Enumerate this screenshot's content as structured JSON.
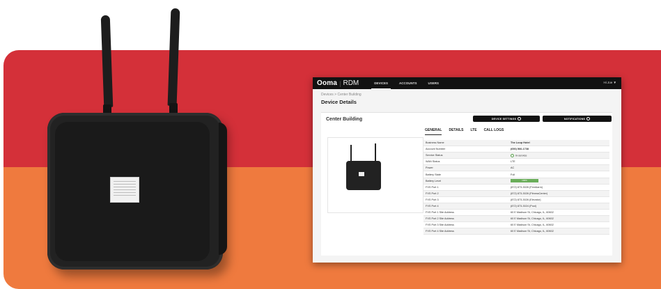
{
  "colors": {
    "red_band": "#d43039",
    "orange_band": "#ef7a3e",
    "accent": "#121212",
    "battery": "#6aad5a"
  },
  "header": {
    "logo": "Ooma",
    "separator": "|",
    "product": "RDM",
    "nav": [
      "DEVICES",
      "ACCOUNTS",
      "USERS"
    ],
    "active_nav": "DEVICES",
    "user": "Hi Joe ▼"
  },
  "breadcrumb": "Devices  >  Center Building",
  "page_title": "Device Details",
  "device": {
    "name": "Center Building",
    "buttons": {
      "settings": "DEVICE SETTINGS",
      "notifications": "NOTIFICATIONS"
    },
    "tabs": [
      "GENERAL",
      "DETAILS",
      "LTE",
      "CALL LOGS"
    ],
    "active_tab": "GENERAL",
    "details": [
      {
        "label": "Business Name",
        "value": "The Loop Hotel"
      },
      {
        "label": "Account Number",
        "value": "(650) 566-1738"
      },
      {
        "label": "Service Status",
        "value": "In-service"
      },
      {
        "label": "WAN Status",
        "value": "LTE"
      },
      {
        "label": "Power",
        "value": "AC"
      },
      {
        "label": "Battery State",
        "value": "Full"
      },
      {
        "label": "Battery Level",
        "value": "100%"
      },
      {
        "label": "FXS Port 1",
        "value": "(872) 873-3026 (FireAlarm)"
      },
      {
        "label": "FXS Port 2",
        "value": "(872) 873-3026 (FitnessCenter)"
      },
      {
        "label": "FXS Port 3",
        "value": "(872) 873-3026 (Elevator)"
      },
      {
        "label": "FXS Port 4",
        "value": "(872) 873-3024 (Pool)"
      },
      {
        "label": "FXS Port 1 Site Address",
        "value": "60 E Madison St, Chicago, IL, 60602"
      },
      {
        "label": "FXS Port 2 Site Address",
        "value": "60 E Madison St, Chicago, IL, 60602"
      },
      {
        "label": "FXS Port 3 Site Address",
        "value": "60 E Madison St, Chicago, IL, 60602"
      },
      {
        "label": "FXS Port 4 Site Address",
        "value": "60 E Madison St, Chicago, IL, 60602"
      }
    ]
  },
  "icons": {
    "settings": "gear-icon",
    "notifications": "bell-icon",
    "status": "status-circle-icon"
  }
}
